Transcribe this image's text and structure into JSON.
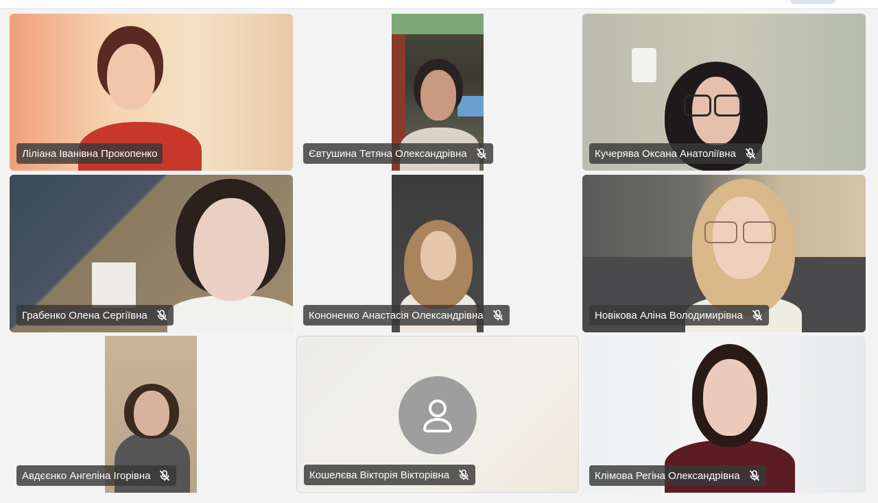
{
  "meeting": {
    "participants": [
      {
        "name": "Ліліана Іванівна Прокопенко",
        "muted": false,
        "video": true
      },
      {
        "name": "Євтушина Тетяна Олександрівна",
        "muted": true,
        "video": true
      },
      {
        "name": "Кучерява Оксана Анатоліївна",
        "muted": true,
        "video": true
      },
      {
        "name": "Грабенко Олена Сергіївна",
        "muted": true,
        "video": true
      },
      {
        "name": "Кононенко Анастасія Олександрівна",
        "muted": true,
        "video": true
      },
      {
        "name": "Новікова Аліна Володимирівна",
        "muted": true,
        "video": true
      },
      {
        "name": "Авдєєнко Ангеліна Ігорівна",
        "muted": true,
        "video": true
      },
      {
        "name": "Кошелєва Вікторія Вікторівна",
        "muted": true,
        "video": false
      },
      {
        "name": "Клімова Регіна Олександрівна",
        "muted": true,
        "video": true
      }
    ]
  },
  "icons": {
    "muted": "microphone-off-icon",
    "avatar": "person-icon"
  },
  "colors": {
    "name_tag_bg": "#383838",
    "avatar_bg": "#9e9e9e",
    "page_bg": "#f3f3f3"
  }
}
